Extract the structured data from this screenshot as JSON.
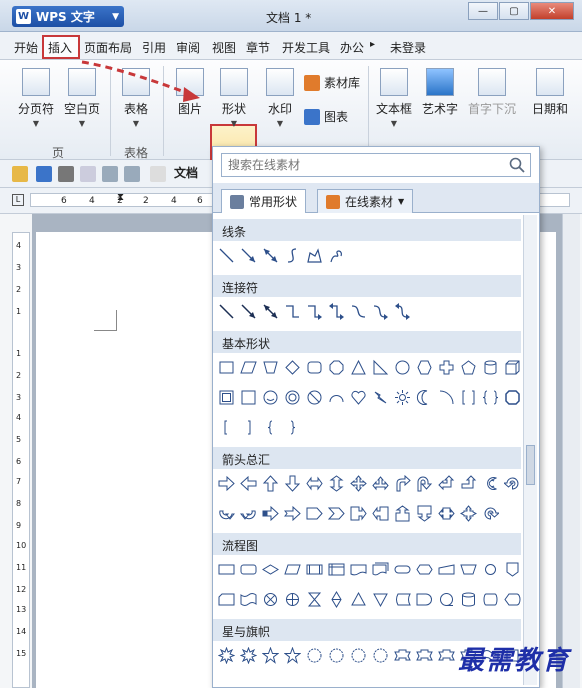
{
  "app": {
    "name": "WPS 文字",
    "logo": "W",
    "doc_title": "文档 1 *"
  },
  "menu": {
    "items": [
      "开始",
      "插入",
      "页面布局",
      "引用",
      "审阅",
      "视图",
      "章节",
      "开发工具",
      "办公"
    ],
    "active": "插入",
    "login": "未登录"
  },
  "ribbon": {
    "page_group": {
      "label": "页",
      "buttons": [
        "分页符",
        "空白页"
      ]
    },
    "table_group": {
      "label": "表格",
      "buttons": [
        "表格"
      ]
    },
    "picture": "图片",
    "shape": "形状",
    "watermark": "水印",
    "material": "素材库",
    "chart": "图表",
    "textbox": "文本框",
    "wordart": "艺术字",
    "dropcap": "首字下沉",
    "date": "日期和"
  },
  "doc_tab": "文档",
  "ruler": {
    "numbers": [
      "6",
      "4",
      "2",
      "2",
      "4",
      "6"
    ],
    "vnumbers": [
      "4",
      "3",
      "2",
      "1",
      "1",
      "2",
      "3",
      "4",
      "5",
      "6",
      "7",
      "8",
      "9",
      "10",
      "11",
      "12",
      "13",
      "14",
      "15"
    ]
  },
  "panel": {
    "search_placeholder": "搜索在线素材",
    "tabs": [
      "常用形状",
      "在线素材"
    ],
    "sections": [
      "线条",
      "连接符",
      "基本形状",
      "箭头总汇",
      "流程图",
      "星与旗帜"
    ]
  },
  "watermark_text": "最需教育",
  "colors": {
    "highlight_red": "#c8383a",
    "shape_blue": "#2d4f8a",
    "wps_blue": "#1d4fa5"
  }
}
